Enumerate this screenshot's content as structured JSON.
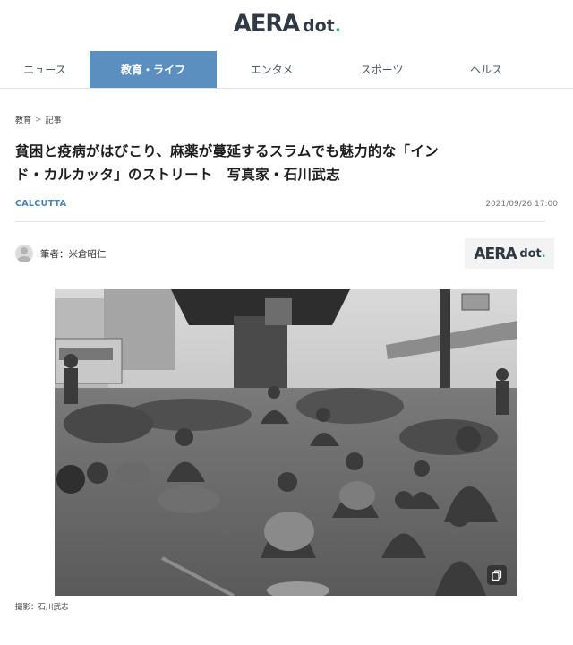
{
  "header": {
    "logo_main": "AERA",
    "logo_sub": "dot",
    "logo_dot_char": "."
  },
  "nav": {
    "items": [
      {
        "label": "ニュース",
        "active": false
      },
      {
        "label": "教育・ライフ",
        "active": true
      },
      {
        "label": "エンタメ",
        "active": false
      },
      {
        "label": "スポーツ",
        "active": false
      },
      {
        "label": "ヘルス",
        "active": false
      }
    ]
  },
  "article": {
    "breadcrumb": [
      "教育",
      "記事"
    ],
    "breadcrumb_sep": ">",
    "title_line1": "貧困と疫病がはびこり、麻薬が蔓延するスラムでも魅力的な「イン",
    "title_line2": "ド・カルカッタ」のストリート　写真家・石川武志",
    "category": "CALCUTTA",
    "date": "2021/09/26 17:00",
    "author_label": "筆者：米倉昭仁",
    "photo_caption": "撮影：石川武志"
  },
  "colors": {
    "accent": "#5b8fbf",
    "category": "#4a82b8",
    "logo_green": "#30b27c",
    "logo_dark": "#2f3a44"
  },
  "icons": {
    "avatar": "user-avatar-icon",
    "copy": "copy-icon"
  }
}
